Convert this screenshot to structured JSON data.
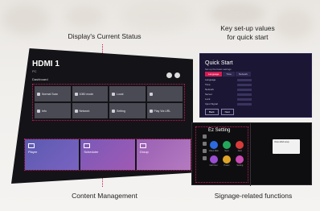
{
  "labels": {
    "status": "Display's Current Status",
    "quick_line1": "Key set-up values",
    "quick_line2": "for quick start",
    "content": "Content Management",
    "signage": "Signage-related functions"
  },
  "tv": {
    "title": "HDMI 1",
    "subtitle": "PC",
    "section": "Dashboard",
    "tiles": [
      "Normal Scan",
      "1080 mode",
      "Local",
      "",
      "Info",
      "Network",
      "Setting",
      "Play Via URL"
    ],
    "content_cards": [
      "Player",
      "Scheduler",
      "Group"
    ]
  },
  "quick_start": {
    "title": "Quick Start",
    "subtitle": "Set up the basic settings",
    "tabs": [
      "Language",
      "Time",
      "Network"
    ],
    "rows": [
      "Language",
      "Time",
      "Network",
      "Server",
      "Lock",
      "Input Signal"
    ],
    "buttons": [
      "Back",
      "Next"
    ]
  },
  "ez_setting": {
    "title": "Ez Setting",
    "apps": [
      "Video Wall",
      "Sync",
      "Alert",
      "Fail Over",
      "Power",
      "Setting"
    ],
    "app_colors": [
      "#2d6ae0",
      "#23a85b",
      "#d93a3a",
      "#9a4fd1",
      "#e0a528",
      "#c94ab0"
    ],
    "tooltip": "Video Wall setup"
  },
  "accent_color": "#c2185b"
}
